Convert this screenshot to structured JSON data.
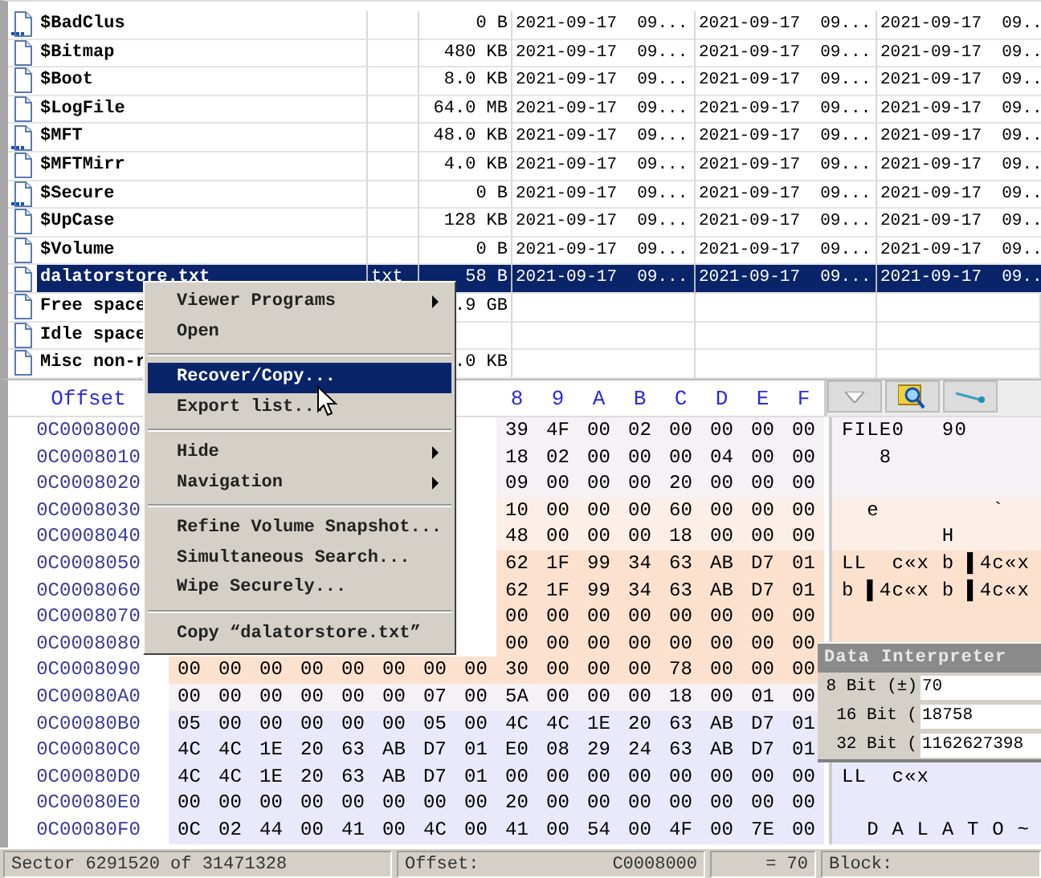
{
  "file_list": {
    "rows": [
      {
        "kind": "special",
        "selected": false,
        "cells": [
          "$BadClus",
          "",
          "0 B",
          "2021-09-17  09...",
          "2021-09-17  09...",
          "2021-09-17  09.."
        ]
      },
      {
        "kind": "file",
        "selected": false,
        "cells": [
          "$Bitmap",
          "",
          "480 KB",
          "2021-09-17  09...",
          "2021-09-17  09...",
          "2021-09-17  09.."
        ]
      },
      {
        "kind": "file",
        "selected": false,
        "cells": [
          "$Boot",
          "",
          "8.0 KB",
          "2021-09-17  09...",
          "2021-09-17  09...",
          "2021-09-17  09.."
        ]
      },
      {
        "kind": "file",
        "selected": false,
        "cells": [
          "$LogFile",
          "",
          "64.0 MB",
          "2021-09-17  09...",
          "2021-09-17  09...",
          "2021-09-17  09.."
        ]
      },
      {
        "kind": "special",
        "selected": false,
        "cells": [
          "$MFT",
          "",
          "48.0 KB",
          "2021-09-17  09...",
          "2021-09-17  09...",
          "2021-09-17  09.."
        ]
      },
      {
        "kind": "file",
        "selected": false,
        "cells": [
          "$MFTMirr",
          "",
          "4.0 KB",
          "2021-09-17  09...",
          "2021-09-17  09...",
          "2021-09-17  09.."
        ]
      },
      {
        "kind": "special",
        "selected": false,
        "cells": [
          "$Secure",
          "",
          "0 B",
          "2021-09-17  09...",
          "2021-09-17  09...",
          "2021-09-17  09.."
        ]
      },
      {
        "kind": "file",
        "selected": false,
        "cells": [
          "$UpCase",
          "",
          "128 KB",
          "2021-09-17  09...",
          "2021-09-17  09...",
          "2021-09-17  09.."
        ]
      },
      {
        "kind": "file",
        "selected": false,
        "cells": [
          "$Volume",
          "",
          "0 B",
          "2021-09-17  09...",
          "2021-09-17  09...",
          "2021-09-17  09.."
        ]
      },
      {
        "kind": "file",
        "selected": true,
        "cells": [
          "dalatorstore.txt",
          "txt",
          "58 B",
          "2021-09-17  09...",
          "2021-09-17  09...",
          "2021-09-17  09.."
        ]
      },
      {
        "kind": "file",
        "selected": false,
        "cells": [
          "Free space",
          "",
          ".9 GB",
          "",
          "",
          ""
        ]
      },
      {
        "kind": "file",
        "selected": false,
        "cells": [
          "Idle space",
          "",
          "",
          "",
          "",
          ""
        ]
      },
      {
        "kind": "file",
        "selected": false,
        "cells": [
          "Misc non-r",
          "",
          ".0 KB",
          "",
          "",
          ""
        ]
      }
    ]
  },
  "hex_view": {
    "offset_label": "Offset",
    "columns": [
      "8",
      "9",
      "A",
      "B",
      "C",
      "D",
      "E",
      "F"
    ],
    "rows": [
      {
        "offset": "0C0008000",
        "kind": "pale",
        "bytes": [
          "39",
          "4F",
          "00",
          "02",
          "00",
          "00",
          "00",
          "00"
        ],
        "text": "FILE0   90"
      },
      {
        "offset": "0C0008010",
        "kind": "pale",
        "bytes": [
          "18",
          "02",
          "00",
          "00",
          "00",
          "04",
          "00",
          "00"
        ],
        "text": "   8"
      },
      {
        "offset": "0C0008020",
        "kind": "pale",
        "bytes": [
          "09",
          "00",
          "00",
          "00",
          "20",
          "00",
          "00",
          "00"
        ]
      },
      {
        "offset": "0C0008030",
        "kind": "blush",
        "bytes": [
          "10",
          "00",
          "00",
          "00",
          "60",
          "00",
          "00",
          "00"
        ],
        "text": "  e         `"
      },
      {
        "offset": "0C0008040",
        "kind": "blush",
        "bytes": [
          "48",
          "00",
          "00",
          "00",
          "18",
          "00",
          "00",
          "00"
        ],
        "text": "        H"
      },
      {
        "offset": "0C0008050",
        "kind": "peach",
        "bytes": [
          "62",
          "1F",
          "99",
          "34",
          "63",
          "AB",
          "D7",
          "01"
        ],
        "text": "LL  c«x b ▌4c«x"
      },
      {
        "offset": "0C0008060",
        "kind": "peach",
        "bytes": [
          "62",
          "1F",
          "99",
          "34",
          "63",
          "AB",
          "D7",
          "01"
        ],
        "text": "b ▌4c«x b ▌4c«x"
      },
      {
        "offset": "0C0008070",
        "kind": "peach",
        "bytes": [
          "00",
          "00",
          "00",
          "00",
          "00",
          "00",
          "00",
          "00"
        ]
      },
      {
        "offset": "0C0008080",
        "kind": "peach",
        "bytes": [
          "00",
          "00",
          "00",
          "00",
          "00",
          "00",
          "00",
          "00"
        ]
      },
      {
        "offset": "0C0008090",
        "kind": "peach",
        "bytes": [
          "00",
          "00",
          "00",
          "00",
          "00",
          "00",
          "00",
          "00",
          "30",
          "00",
          "00",
          "00",
          "78",
          "00",
          "00",
          "00"
        ]
      },
      {
        "offset": "0C00080A0",
        "kind": "pale",
        "bytes": [
          "00",
          "00",
          "00",
          "00",
          "00",
          "00",
          "07",
          "00",
          "5A",
          "00",
          "00",
          "00",
          "18",
          "00",
          "01",
          "00"
        ]
      },
      {
        "offset": "0C00080B0",
        "kind": "lavender",
        "bytes": [
          "05",
          "00",
          "00",
          "00",
          "00",
          "00",
          "05",
          "00",
          "4C",
          "4C",
          "1E",
          "20",
          "63",
          "AB",
          "D7",
          "01"
        ]
      },
      {
        "offset": "0C00080C0",
        "kind": "lavender",
        "bytes": [
          "4C",
          "4C",
          "1E",
          "20",
          "63",
          "AB",
          "D7",
          "01",
          "E0",
          "08",
          "29",
          "24",
          "63",
          "AB",
          "D7",
          "01"
        ]
      },
      {
        "offset": "0C00080D0",
        "kind": "lavender",
        "bytes": [
          "4C",
          "4C",
          "1E",
          "20",
          "63",
          "AB",
          "D7",
          "01",
          "00",
          "00",
          "00",
          "00",
          "00",
          "00",
          "00",
          "00"
        ],
        "text": "LL  c«x"
      },
      {
        "offset": "0C00080E0",
        "kind": "lavender",
        "bytes": [
          "00",
          "00",
          "00",
          "00",
          "00",
          "00",
          "00",
          "00",
          "20",
          "00",
          "00",
          "00",
          "00",
          "00",
          "00",
          "00"
        ]
      },
      {
        "offset": "0C00080F0",
        "kind": "lavender",
        "bytes": [
          "0C",
          "02",
          "44",
          "00",
          "41",
          "00",
          "4C",
          "00",
          "41",
          "00",
          "54",
          "00",
          "4F",
          "00",
          "7E",
          "00"
        ],
        "text": "  D A L A T O ~"
      }
    ]
  },
  "context_menu": {
    "items": [
      {
        "kind": "item",
        "label": "Viewer Programs",
        "submenu": true,
        "selected": false
      },
      {
        "kind": "item",
        "label": "Open",
        "submenu": false,
        "selected": false
      },
      {
        "kind": "separator"
      },
      {
        "kind": "item",
        "label": "Recover/Copy...",
        "submenu": false,
        "selected": true
      },
      {
        "kind": "item",
        "label": "Export list...",
        "submenu": false,
        "selected": false
      },
      {
        "kind": "separator"
      },
      {
        "kind": "item",
        "label": "Hide",
        "submenu": true,
        "selected": false
      },
      {
        "kind": "item",
        "label": "Navigation",
        "submenu": true,
        "selected": false
      },
      {
        "kind": "separator"
      },
      {
        "kind": "item",
        "label": "Refine Volume Snapshot...",
        "submenu": false,
        "selected": false
      },
      {
        "kind": "item",
        "label": "Simultaneous Search...",
        "submenu": false,
        "selected": false
      },
      {
        "kind": "item",
        "label": "Wipe Securely...",
        "submenu": false,
        "selected": false
      },
      {
        "kind": "separator"
      },
      {
        "kind": "item",
        "label": "Copy “dalatorstore.txt”",
        "submenu": false,
        "selected": false
      }
    ]
  },
  "data_interpreter": {
    "title": "Data Interpreter",
    "rows": [
      {
        "label": "8 Bit (±)",
        "value": "70"
      },
      {
        "label": "16 Bit (",
        "value": "18758"
      },
      {
        "label": "32 Bit (",
        "value": "1162627398"
      }
    ]
  },
  "status_bar": {
    "sector": "Sector 6291520 of 31471328",
    "offset_label": "Offset:",
    "offset": "C0008000",
    "value": "= 70",
    "block_label": "Block:"
  }
}
